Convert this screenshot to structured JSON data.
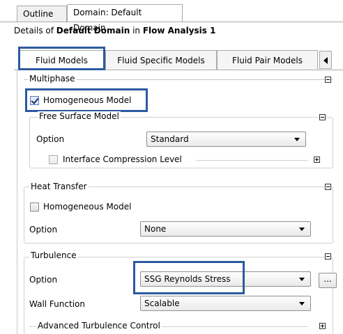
{
  "top_tabs": [
    {
      "label": "Outline"
    },
    {
      "label": "Domain: Default Domain"
    }
  ],
  "details": {
    "prefix": "Details of ",
    "object": "Default Domain",
    "mid": " in ",
    "analysis": "Flow Analysis 1"
  },
  "inner_tabs": [
    {
      "label": "Fluid Models"
    },
    {
      "label": "Fluid Specific Models"
    },
    {
      "label": "Fluid Pair Models"
    }
  ],
  "multiphase": {
    "header": "Multiphase",
    "homogeneous_label": "Homogeneous Model",
    "homogeneous_checked": true,
    "free_surface": {
      "header": "Free Surface Model",
      "option_label": "Option",
      "option_value": "Standard",
      "interface_label": "Interface Compression Level",
      "interface_checked": false
    }
  },
  "heat_transfer": {
    "header": "Heat Transfer",
    "homogeneous_label": "Homogeneous Model",
    "homogeneous_checked": false,
    "option_label": "Option",
    "option_value": "None"
  },
  "turbulence": {
    "header": "Turbulence",
    "option_label": "Option",
    "option_value": "SSG Reynolds Stress",
    "ellipsis_label": "...",
    "wall_function_label": "Wall Function",
    "wall_function_value": "Scalable",
    "advanced_label": "Advanced Turbulence Control"
  },
  "colors": {
    "highlight": "#2c5aa0"
  }
}
